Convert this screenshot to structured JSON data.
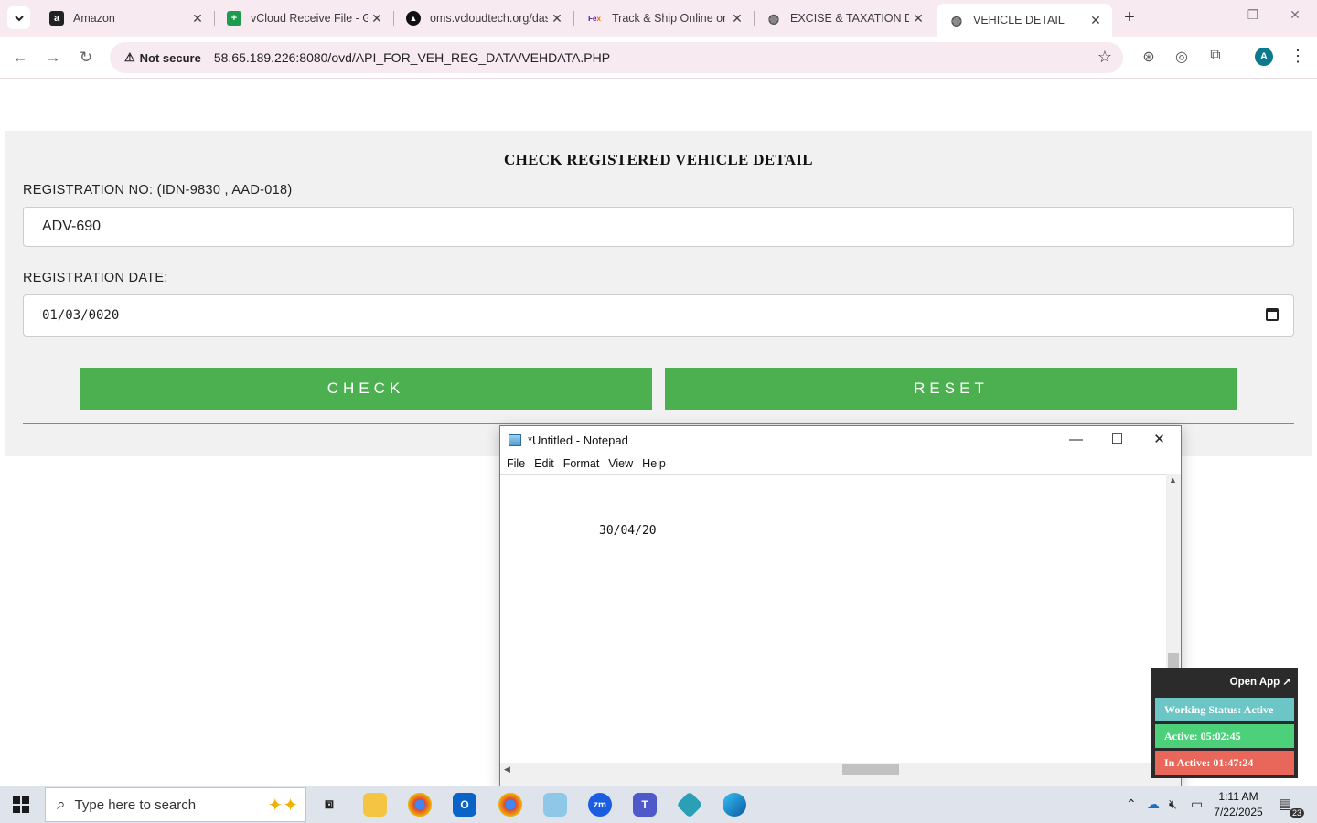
{
  "browser": {
    "tabs": [
      {
        "title": "Amazon",
        "favicon": "amazon-icon",
        "active": false
      },
      {
        "title": "vCloud Receive File - Go",
        "favicon": "sheets-icon",
        "active": false
      },
      {
        "title": "oms.vcloudtech.org/das",
        "favicon": "vcloud-icon",
        "active": false
      },
      {
        "title": "Track & Ship Online or F",
        "favicon": "fedex-icon",
        "active": false
      },
      {
        "title": "EXCISE & TAXATION DE",
        "favicon": "globe-icon",
        "active": false
      },
      {
        "title": "VEHICLE DETAIL",
        "favicon": "globe-icon",
        "active": true
      }
    ],
    "security_label": "Not secure",
    "url": "58.65.189.226:8080/ovd/API_FOR_VEH_REG_DATA/VEHDATA.PHP",
    "profile_initial": "A"
  },
  "page": {
    "heading": "CHECK REGISTERED VEHICLE DETAIL",
    "reg_no_label": "REGISTRATION NO: (IDN-9830 , AAD-018)",
    "reg_no_value": "ADV-690",
    "reg_date_label": "REGISTRATION DATE:",
    "reg_date_value": "01/03/0020",
    "check_label": "CHECK",
    "reset_label": "RESET",
    "button_color": "#4caf50"
  },
  "notepad": {
    "title": "*Untitled - Notepad",
    "menu": [
      "File",
      "Edit",
      "Format",
      "View",
      "Help"
    ],
    "content": "30/04/20"
  },
  "tracker": {
    "open_label": "Open App ↗",
    "status": "Working Status: Active",
    "active": "Active: 05:02:45",
    "inactive": "In Active: 01:47:24",
    "status_color": "#6cc6c6",
    "active_color": "#4cd17a",
    "inactive_color": "#e8675a"
  },
  "taskbar": {
    "search_placeholder": "Type here to search",
    "time": "1:11 AM",
    "date": "7/22/2025",
    "notification_count": "23"
  }
}
